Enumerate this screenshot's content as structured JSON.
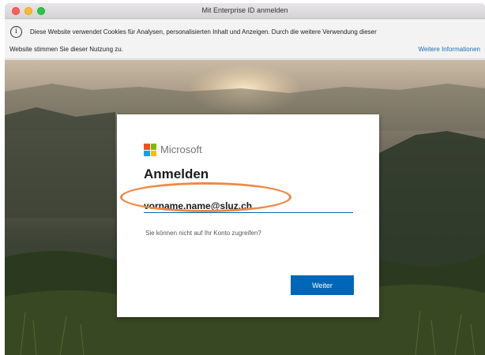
{
  "window": {
    "title": "Mit Enterprise ID anmelden"
  },
  "cookie_notice": {
    "icon": "info-icon",
    "icon_glyph": "i",
    "line1": "Diese Website verwendet Cookies für Analysen, personalisierten Inhalt und Anzeigen. Durch die weitere Verwendung dieser",
    "line2": "Website stimmen Sie dieser Nutzung zu.",
    "more_link": "Weitere Informationen"
  },
  "login": {
    "brand": "Microsoft",
    "heading": "Anmelden",
    "email_value": "vorname.name@sluz.ch",
    "help_link": "Sie können nicht auf Ihr Konto zugreifen?",
    "next_button": "Weiter"
  },
  "colors": {
    "accent": "#0067b8",
    "highlight": "#ef8a45",
    "link": "#1a6fb5"
  }
}
